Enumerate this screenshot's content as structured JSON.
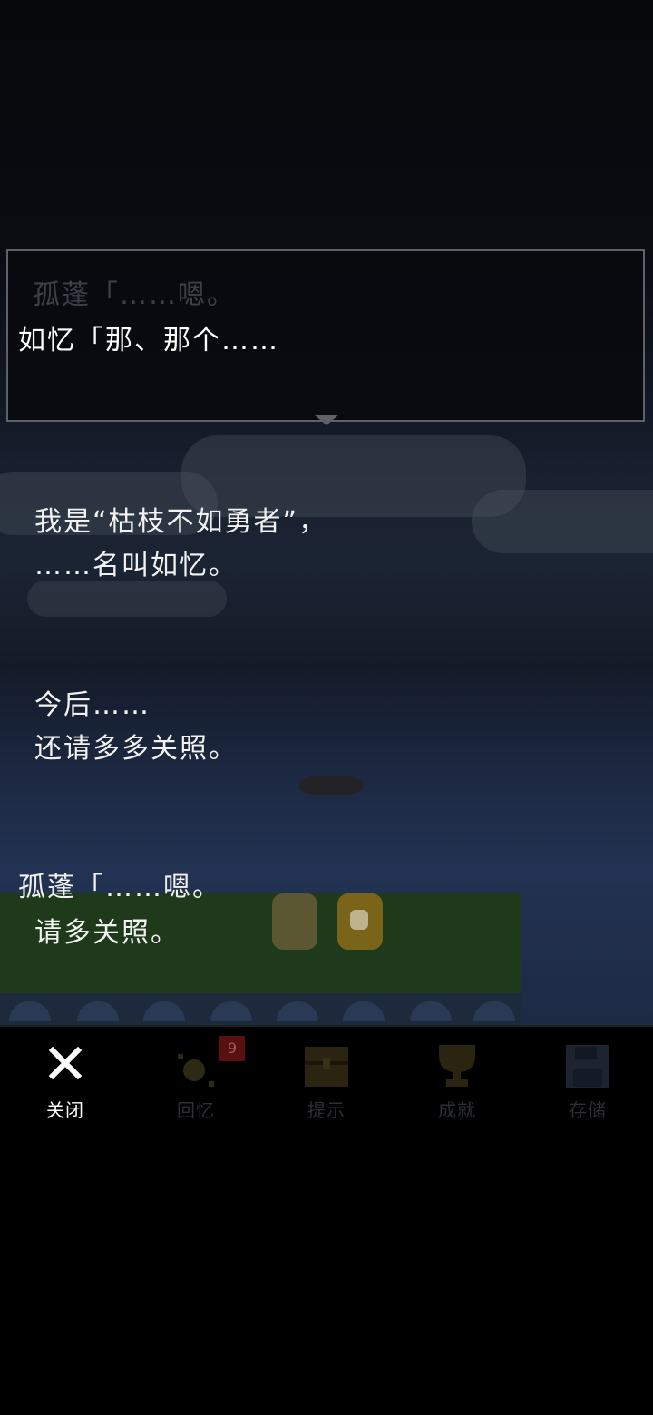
{
  "dialog": {
    "previous_line": "孤蓬「……嗯。",
    "current_line": "如忆「那、那个……"
  },
  "backlog": [
    {
      "line1": "我是“枯枝不如勇者”，",
      "line2": "……名叫如忆。"
    },
    {
      "line1": "今后……",
      "line2": "还请多多关照。"
    },
    {
      "line1": "孤蓬「……嗯。",
      "line2": "请多关照。"
    }
  ],
  "toolbar": {
    "close_label": "关闭",
    "memory_label": "回忆",
    "memory_badge": "9",
    "hint_label": "提示",
    "achievement_label": "成就",
    "save_label": "存储"
  }
}
